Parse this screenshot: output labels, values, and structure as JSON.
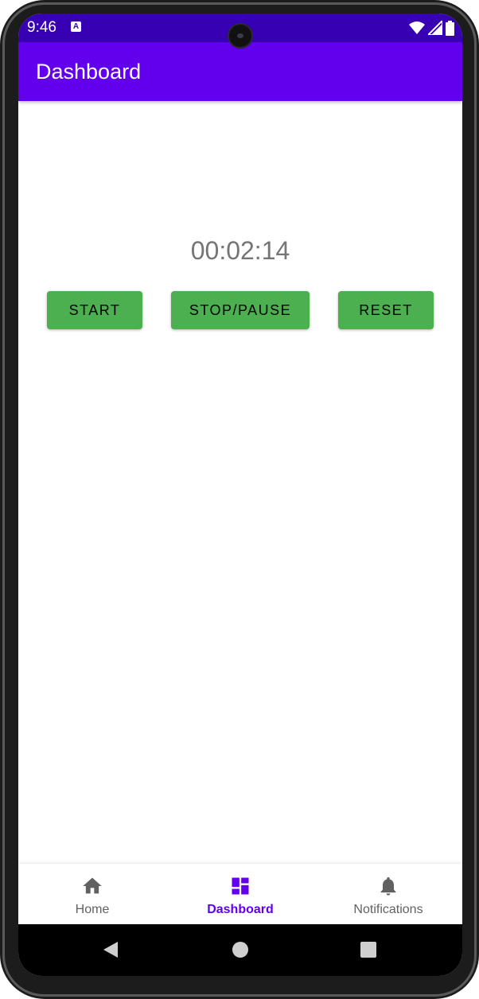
{
  "status_bar": {
    "time": "9:46",
    "app_icon_letter": "A"
  },
  "app_bar": {
    "title": "Dashboard"
  },
  "stopwatch": {
    "time_display": "00:02:14",
    "start_label": "START",
    "stop_label": "STOP/PAUSE",
    "reset_label": "RESET"
  },
  "bottom_nav": {
    "items": [
      {
        "label": "Home",
        "icon": "home-icon",
        "selected": false
      },
      {
        "label": "Dashboard",
        "icon": "dashboard-icon",
        "selected": true
      },
      {
        "label": "Notifications",
        "icon": "bell-icon",
        "selected": false
      }
    ]
  },
  "colors": {
    "primary": "#6200ee",
    "primary_dark": "#3700b3",
    "button": "#4caf50",
    "timer_text": "#757575"
  },
  "system_nav": {
    "icons": [
      "back-icon",
      "home-circle-icon",
      "recents-icon"
    ]
  }
}
